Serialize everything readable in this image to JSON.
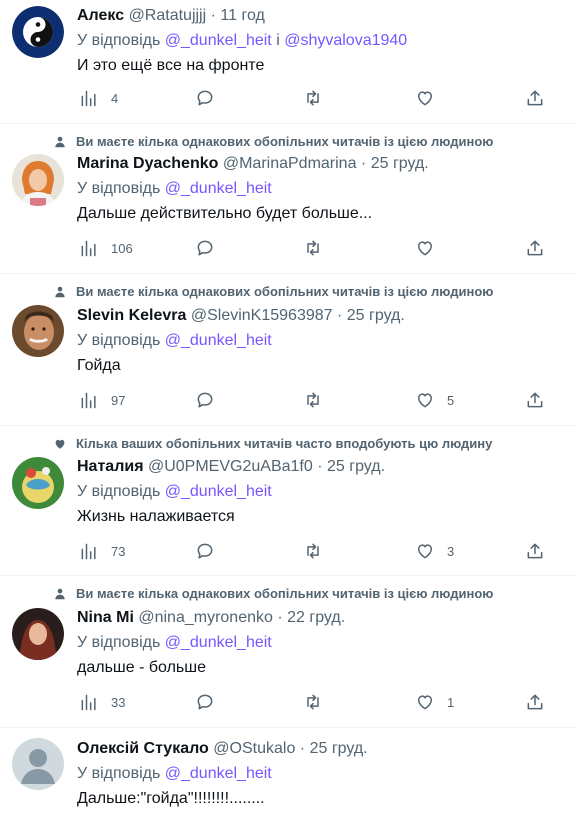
{
  "colors": {
    "accent": "#7856ff",
    "secondary": "#536471",
    "text": "#0f1419",
    "divider": "#eff3f4"
  },
  "icons": {
    "views": "bar-chart-icon",
    "reply": "speech-bubble-icon",
    "retweet": "retweet-icon",
    "like": "heart-icon",
    "share": "upload-icon",
    "social_person": "person-icon",
    "social_heart": "heart-filled-icon"
  },
  "tweets": [
    {
      "social": "",
      "name": "Алекс",
      "handle": "@Ratatujjjj",
      "dot": "·",
      "time": "11 год",
      "reply_prefix": "У відповідь",
      "reply_to": "@_dunkel_heit",
      "reply_conj": "і",
      "reply_to2": "@shyvalova1940",
      "text": "И это ещё все на фронте",
      "views": "4",
      "replies": "",
      "retweets": "",
      "likes": ""
    },
    {
      "social": "Ви маєте кілька однакових обопільних читачів із цією людиною",
      "name": "Marina Dyachenko",
      "handle": "@MarinaPdmarina",
      "dot": "·",
      "time": "25 груд.",
      "reply_prefix": "У відповідь",
      "reply_to": "@_dunkel_heit",
      "text": "Дальше действительно будет больше...",
      "views": "106",
      "replies": "",
      "retweets": "",
      "likes": ""
    },
    {
      "social": "Ви маєте кілька однакових обопільних читачів із цією людиною",
      "name": "Slevin Kelevra",
      "handle": "@SlevinK15963987",
      "dot": "·",
      "time": "25 груд.",
      "reply_prefix": "У відповідь",
      "reply_to": "@_dunkel_heit",
      "text": "Гойда",
      "views": "97",
      "replies": "",
      "retweets": "",
      "likes": "5"
    },
    {
      "social": "Кілька ваших обопільних читачів часто вподобують цю людину",
      "name": "Наталия",
      "handle": "@U0PMEVG2uABa1f0",
      "dot": "·",
      "time": "25 груд.",
      "reply_prefix": "У відповідь",
      "reply_to": "@_dunkel_heit",
      "text": "Жизнь налаживается",
      "views": "73",
      "replies": "",
      "retweets": "",
      "likes": "3"
    },
    {
      "social": "Ви маєте кілька однакових обопільних читачів із цією людиною",
      "name": "Nina Mi",
      "handle": "@nina_myronenko",
      "dot": "·",
      "time": "22 груд.",
      "reply_prefix": "У відповідь",
      "reply_to": "@_dunkel_heit",
      "text": "дальше - больше",
      "views": "33",
      "replies": "",
      "retweets": "",
      "likes": "1"
    },
    {
      "social": "",
      "name": "Олексій Стукало",
      "handle": "@OStukalo",
      "dot": "·",
      "time": "25 груд.",
      "reply_prefix": "У відповідь",
      "reply_to": "@_dunkel_heit",
      "text": "Дальше:\"гойда\"!!!!!!!!........",
      "views": "",
      "replies": "",
      "retweets": "",
      "likes": ""
    }
  ]
}
